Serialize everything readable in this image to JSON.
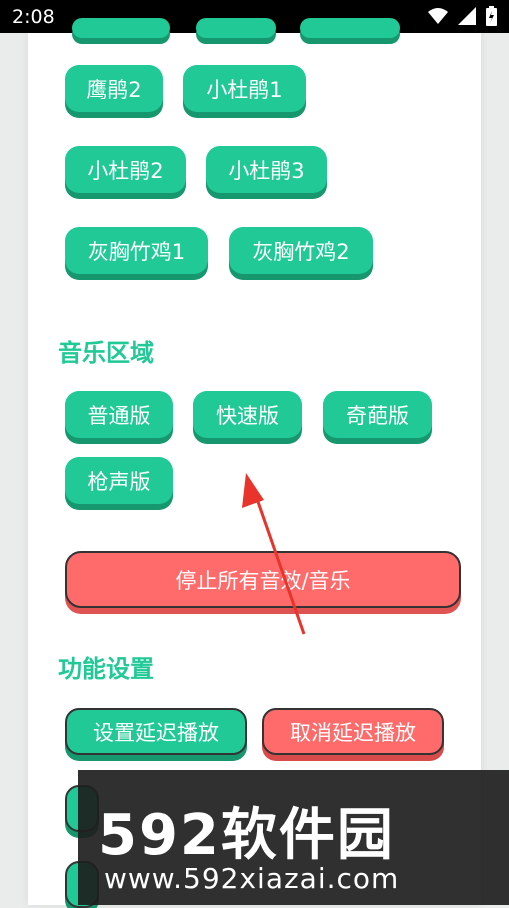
{
  "status": {
    "time": "2:08",
    "icons": [
      "wifi-icon",
      "signal-icon",
      "battery-icon"
    ]
  },
  "bird_buttons": [
    "鹰鹃2",
    "小杜鹃1",
    "小杜鹃2",
    "小杜鹃3",
    "灰胸竹鸡1",
    "灰胸竹鸡2"
  ],
  "music_section": {
    "title": "音乐区域",
    "buttons": [
      "普通版",
      "快速版",
      "奇葩版",
      "枪声版"
    ]
  },
  "stop_all": "停止所有音效/音乐",
  "function_section": {
    "title": "功能设置",
    "buttons": [
      "设置延迟播放",
      "取消延迟播放"
    ]
  },
  "watermark": {
    "logo_text": "592软件园",
    "url": "www.592xiazai.com"
  },
  "colors": {
    "accent": "#21c996",
    "danger": "#ff6b6b"
  }
}
